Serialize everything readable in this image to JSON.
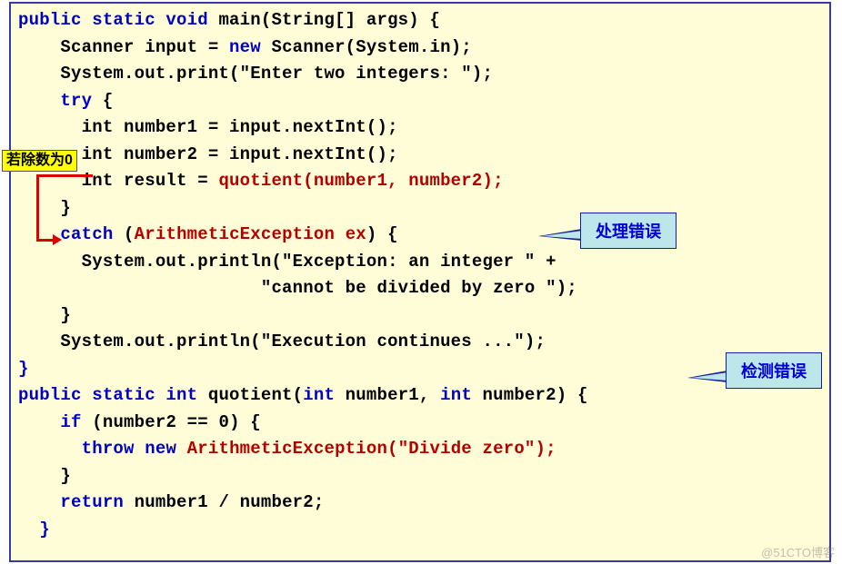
{
  "code": {
    "l1": {
      "a": "public static void",
      "b": " main(String[] args) {"
    },
    "l2": "    Scanner input = ",
    "l2b": "new",
    "l2c": " Scanner(System.in);",
    "l3": "    System.out.print(\"Enter two integers: \");",
    "l4a": "    ",
    "l4b": "try",
    "l4c": " {",
    "l5": "      int number1 = input.nextInt();",
    "l6": "      int number2 = input.nextInt();",
    "l7a": "      int result = ",
    "l7b": "quotient(number1, number2);",
    "l8": "    }",
    "l9a": "    ",
    "l9b": "catch",
    "l9c": " (",
    "l9d": "ArithmeticException ex",
    "l9e": ") {",
    "l10": "      System.out.println(\"Exception: an integer \" +",
    "l11": "                       \"cannot be divided by zero \");",
    "l12": "    }",
    "l13": "    System.out.println(\"Execution continues ...\");",
    "l14": "}",
    "l15a": "public static int",
    "l15b": " quotient(",
    "l15c": "int",
    "l15d": " number1, ",
    "l15e": "int",
    "l15f": " number2) {",
    "l16a": "    ",
    "l16b": "if",
    "l16c": " (number2 == 0) {",
    "l17a": "      ",
    "l17b": "throw new",
    "l17c": " ",
    "l17d": "ArithmeticException(\"Divide zero\");",
    "l18": "    }",
    "l19a": "    ",
    "l19b": "return",
    "l19c": " number1 / number2;",
    "l20": "  }"
  },
  "annotations": {
    "divisor_zero": "若除数为0",
    "handle_error": "处理错误",
    "detect_error": "检测错误"
  },
  "watermark": "@51CTO博客"
}
